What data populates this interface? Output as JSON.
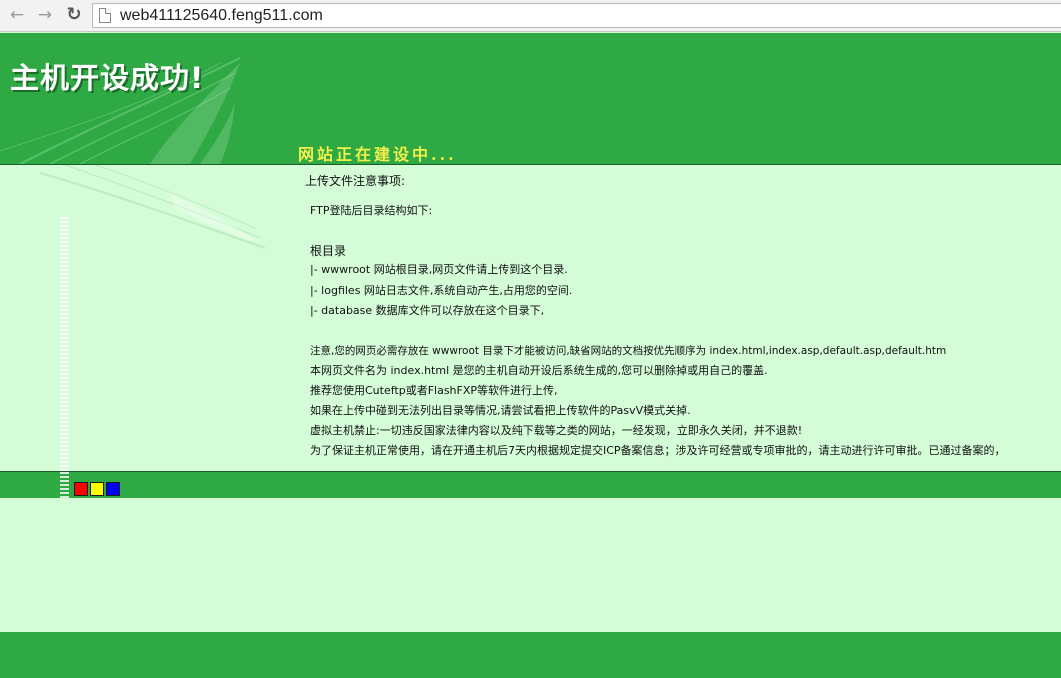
{
  "browser": {
    "url": "web411125640.feng511.com",
    "back_glyph": "←",
    "forward_glyph": "→",
    "reload_glyph": "↻"
  },
  "header": {
    "title": "主机开设成功!",
    "subtitle": "网站正在建设中..."
  },
  "notice": {
    "heading": "上传文件注意事项:",
    "lines": [
      "FTP登陆后目录结构如下:",
      "根目录",
      "|- wwwroot 网站根目录,网页文件请上传到这个目录.",
      "|- logfiles 网站日志文件,系统自动产生,占用您的空间.",
      "|- database 数据库文件可以存放在这个目录下,",
      "注意,您的网页必需存放在 wwwroot 目录下才能被访问,缺省网站的文档按优先顺序为 index.html,index.asp,default.asp,default.htm",
      "本网页文件名为 index.html 是您的主机自动开设后系统生成的,您可以删除掉或用自己的覆盖.",
      "推荐您使用Cuteftp或者FlashFXP等软件进行上传,",
      "如果在上传中碰到无法列出目录等情况,请尝试看把上传软件的PasvV模式关掉.",
      "虚拟主机禁止:一切违反国家法律内容以及纯下载等之类的网站，一经发现，立即永久关闭，并不退款!",
      "为了保证主机正常使用，请在开通主机后7天内根据规定提交ICP备案信息；涉及许可经营或专项审批的，请主动进行许可审批。已通过备案的，"
    ]
  },
  "colors": {
    "green": "#2fa944",
    "light_green": "#d4fcd7",
    "subtitle_yellow": "#f4ef4a",
    "swatch_red": "#ff0000",
    "swatch_yellow": "#ffff00",
    "swatch_blue": "#0000ff"
  },
  "icons": [
    "back-arrow-icon",
    "forward-arrow-icon",
    "reload-icon",
    "page-icon",
    "feather-graphic"
  ]
}
